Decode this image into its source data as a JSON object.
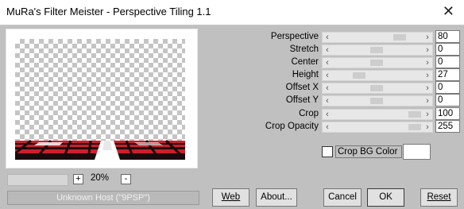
{
  "window": {
    "title": "MuRa's Filter Meister - Perspective Tiling 1.1"
  },
  "preview": {
    "zoom_minus": "-",
    "zoom_plus": "+",
    "zoom_value": "20%",
    "status_text": "Unknown Host (\"9PSP\")"
  },
  "parameters": [
    {
      "label": "Perspective",
      "value": "80",
      "level": 0.8
    },
    {
      "label": "Stretch",
      "value": "0",
      "level": 0.5
    },
    {
      "label": "Center",
      "value": "0",
      "level": 0.5
    },
    {
      "label": "Height",
      "value": "27",
      "level": 0.27
    },
    {
      "label": "Offset X",
      "value": "0",
      "level": 0.5
    },
    {
      "label": "Offset Y",
      "value": "0",
      "level": 0.5
    },
    {
      "label": "Crop",
      "value": "100",
      "level": 1.0
    },
    {
      "label": "Crop Opacity",
      "value": "255",
      "level": 1.0
    }
  ],
  "crop_bg": {
    "label": "Crop BG Color",
    "checked": false,
    "color": "#ffffff"
  },
  "buttons": {
    "web": "Web",
    "about": "About...",
    "cancel": "Cancel",
    "ok": "OK",
    "reset": "Reset"
  },
  "colors": {
    "tile_red": "#cc1f2c",
    "tile_dark": "#1a0a0c",
    "tile_white": "#ffffff"
  }
}
